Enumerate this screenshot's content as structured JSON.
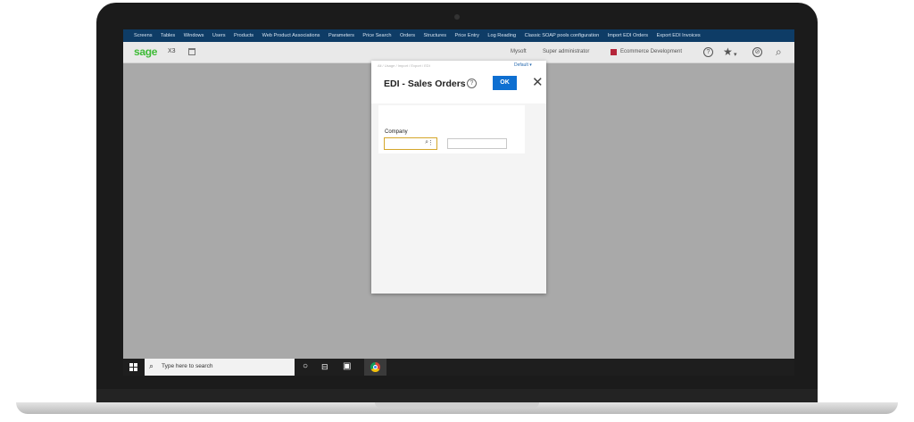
{
  "nav": [
    "Screens",
    "Tables",
    "Windows",
    "Users",
    "Products",
    "Web Product Associations",
    "Parameters",
    "Price Search",
    "Orders",
    "Structures",
    "Price Entry",
    "Log Reading",
    "Classic SOAP pools configuration",
    "Import EDI Orders",
    "Export EDI Invoices"
  ],
  "header": {
    "logo": "sage",
    "product": "X3",
    "company": "Mysoft",
    "user": "Super administrator",
    "folder": "Ecommerce Development"
  },
  "dialog": {
    "breadcrumb": "All  /  Usage  /  Import / Export  /  EDI",
    "default_label": "Default",
    "title": "EDI - Sales Orders",
    "ok_label": "OK",
    "close_glyph": "✕",
    "company_label": "Company",
    "company_value": "",
    "company_description": ""
  },
  "taskbar": {
    "search_placeholder": "Type here to search"
  },
  "colors": {
    "nav_bg": "#0e3c66",
    "ok_button": "#0e6fd1",
    "sage_green": "#3dbb36",
    "folder_red": "#b5253a",
    "field_focus": "#d4a62a"
  }
}
